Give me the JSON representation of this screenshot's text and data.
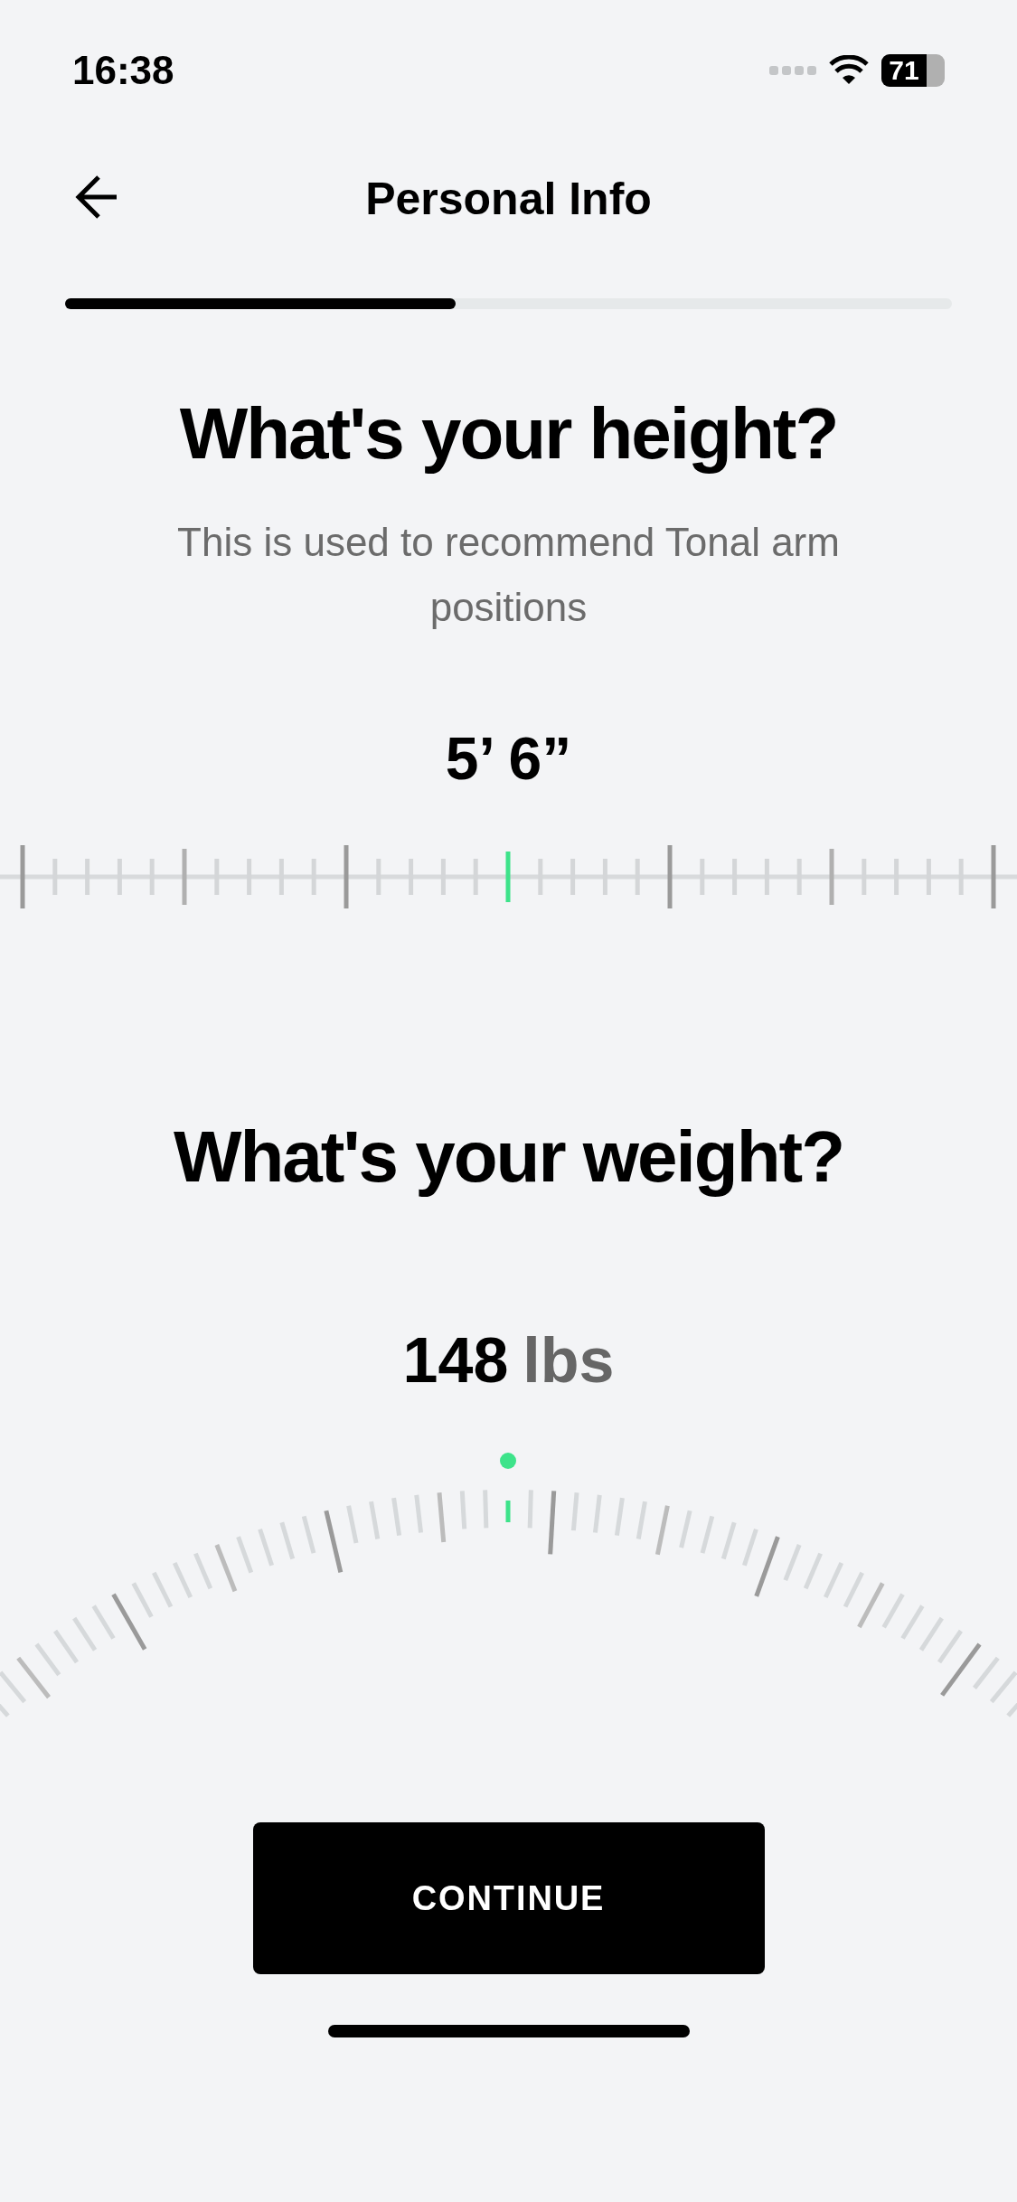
{
  "status_bar": {
    "time": "16:38",
    "battery": "71"
  },
  "nav": {
    "title": "Personal Info"
  },
  "progress": {
    "level": 0.44
  },
  "height": {
    "title": "What's your height?",
    "subtitle": "This is used to recommend Tonal arm positions",
    "value": "5’ 6”"
  },
  "weight": {
    "title": "What's your weight?",
    "value": "148",
    "unit": "lbs"
  },
  "button": {
    "label": "CONTINUE"
  }
}
